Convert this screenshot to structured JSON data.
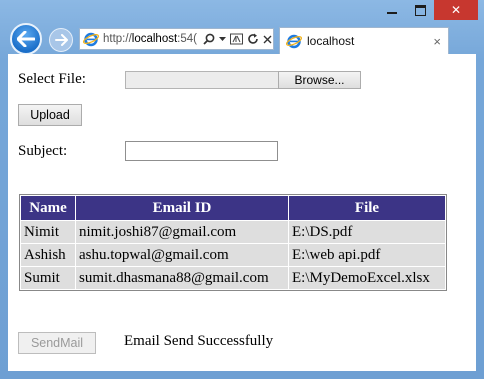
{
  "browser": {
    "url_prefix": "http://",
    "url_host": "localhost",
    "url_rest": ":54(",
    "tab_title": "localhost",
    "tab_close": "×",
    "icons": [
      "back-icon",
      "forward-icon",
      "ie-icon",
      "search-icon",
      "dropdown-icon",
      "compat-icon",
      "refresh-icon",
      "close-icon"
    ]
  },
  "window": {
    "minimize": "",
    "maximize": "",
    "close": "✕"
  },
  "form": {
    "select_file_label": "Select File:",
    "browse_label": "Browse...",
    "file_value": "",
    "upload_label": "Upload",
    "subject_label": "Subject:",
    "subject_value": ""
  },
  "table": {
    "headers": [
      "Name",
      "Email ID",
      "File"
    ],
    "rows": [
      [
        "Nimit",
        "nimit.joshi87@gmail.com",
        "E:\\DS.pdf"
      ],
      [
        "Ashish",
        "ashu.topwal@gmail.com",
        "E:\\web api.pdf"
      ],
      [
        "Sumit",
        "sumit.dhasmana88@gmail.com",
        "E:\\MyDemoExcel.xlsx"
      ]
    ]
  },
  "footer": {
    "sendmail_label": "SendMail",
    "status_text": "Email Send Successfully"
  },
  "colors": {
    "header_bg": "#3c3486",
    "cell_bg": "#dedede",
    "close_btn": "#c7372f"
  }
}
